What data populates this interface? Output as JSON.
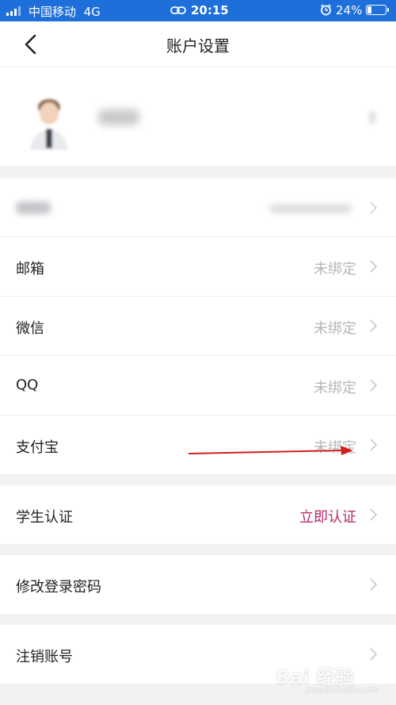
{
  "status_bar": {
    "carrier": "中国移动",
    "network": "4G",
    "time": "20:15",
    "battery_percent_label": "24%",
    "battery_level": 0.24,
    "icons": [
      "signal-icon",
      "link-icon",
      "alarm-icon",
      "battery-icon"
    ]
  },
  "header": {
    "title": "账户设置",
    "back_icon": "chevron-left-icon"
  },
  "rows": [
    {
      "label": "邮箱",
      "value": "未绑定"
    },
    {
      "label": "微信",
      "value": "未绑定"
    },
    {
      "label": "QQ",
      "value": "未绑定"
    },
    {
      "label": "支付宝",
      "value": "未绑定"
    }
  ],
  "student": {
    "label": "学生认证",
    "value": "立即认证",
    "value_color": "#b42a6a"
  },
  "password": {
    "label": "修改登录密码"
  },
  "cancel": {
    "label": "注销账号"
  },
  "colors": {
    "status_bar": "#1e6fd9",
    "page_bg": "#f2f2f4",
    "annotation_arrow": "#d0201c"
  },
  "watermark": {
    "text": "Bai 经验",
    "url": "jingyan.baidu.com"
  }
}
